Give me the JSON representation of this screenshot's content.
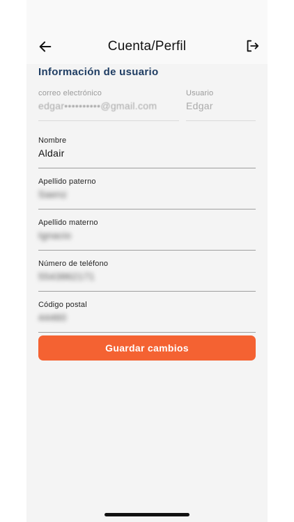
{
  "header": {
    "title": "Cuenta/Perfil",
    "back_icon": "arrow-left-icon",
    "logout_icon": "logout-icon"
  },
  "section": {
    "title": "Información de usuario"
  },
  "fields": {
    "email": {
      "label": "correo electrónico",
      "value": "edgar••••••••••@gmail.com"
    },
    "username": {
      "label": "Usuario",
      "value": "Edgar"
    },
    "nombre": {
      "label": "Nombre",
      "value": "Aldair"
    },
    "apellido_paterno": {
      "label": "Apellido paterno",
      "value": "Saenz"
    },
    "apellido_materno": {
      "label": "Apellido materno",
      "value": "Ignacio"
    },
    "telefono": {
      "label": "Número de teléfono",
      "value": "5543862171"
    },
    "codigo_postal": {
      "label": "Código postal",
      "value": "44460"
    }
  },
  "actions": {
    "save_label": "Guardar cambios"
  },
  "colors": {
    "accent": "#f46232",
    "section_title": "#1f3d63",
    "background": "#f4f4f4"
  }
}
